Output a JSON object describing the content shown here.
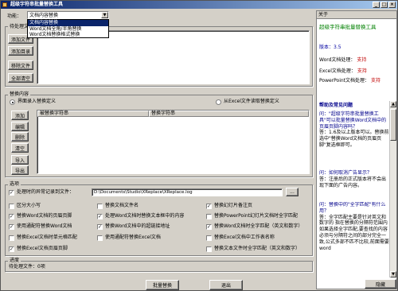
{
  "window": {
    "title": "超级字符串批量替换工具",
    "min": "_",
    "max": "□",
    "close": "×"
  },
  "function": {
    "label": "功能：",
    "selected": "文档内容替换",
    "options": [
      "文档内容替换",
      "Word文档全角/半角替换",
      "Word文档替换格式替换"
    ]
  },
  "files": {
    "group_label": "待处理文件",
    "buttons": [
      "添加文件",
      "添加目录",
      "移除文件",
      "全部清空"
    ]
  },
  "replace": {
    "group_label": "替换内容",
    "radio_ui": "界面录入替换定义",
    "radio_excel": "从Excel文件读取替换定义",
    "col_from": "被替换字符串",
    "col_to": "替换字符串",
    "buttons": [
      "添加",
      "编辑",
      "删除",
      "清空",
      "导入",
      "导出"
    ]
  },
  "options": {
    "group_label": "选项",
    "log_label": "处理时的异常记录到文件：",
    "log_path": "D:\\Documents\\Studio\\XReplace\\XReplace.log",
    "browse": "...",
    "items": [
      {
        "label": "区分大小写",
        "checked": false
      },
      {
        "label": "替换文档文件名",
        "checked": false
      },
      {
        "label": "替换幻灯片备注页",
        "checked": true
      },
      {
        "label": "替换Word文档的页眉页脚",
        "checked": true
      },
      {
        "label": "处理Word文档时替换文本框中的内容",
        "checked": true
      },
      {
        "label": "替换PowerPoint幻灯片文档时全字匹配",
        "checked": false
      },
      {
        "label": "使用通配符替换Word文档",
        "checked": true
      },
      {
        "label": "替换Word文档中的超链接地址",
        "checked": true
      },
      {
        "label": "替换Word文档时全字匹配（英文和数字）",
        "checked": true
      },
      {
        "label": "替换Excel文档时单元格匹配",
        "checked": false
      },
      {
        "label": "使用通配符替换Excel文档",
        "checked": false
      },
      {
        "label": "替换Excel文档中工作表名称",
        "checked": false
      },
      {
        "label": "替换Excel文档页眉页脚",
        "checked": true
      },
      {
        "label": "",
        "checked": false
      },
      {
        "label": "替换文本文件时全字匹配（英文和数字）",
        "checked": false
      }
    ]
  },
  "progress": {
    "group_label": "进度",
    "text": "待处理文件：0项"
  },
  "actions": {
    "run": "批量替换",
    "exit": "退出",
    "hide": "隐藏"
  },
  "about": {
    "title": "关于",
    "app_name": "超级字符串批量替换工具",
    "version": "版本：3.5",
    "word_label": "Word文档处理：",
    "word_status": "支持",
    "excel_label": "Excel文档处理：",
    "excel_status": "支持",
    "ppt_label": "PowerPoint文档处理：",
    "ppt_status": "支持",
    "help_title": "帮助及常见问题",
    "faq": [
      {
        "q": "问：\"超级字符串批量替换工具\"可以批量替换Word文档中的页眉页脚内容吗？",
        "a": "答：1.6及以上版本可以。替换前选中\"替换Word文档的页眉页脚\"复选框即可。"
      },
      {
        "q": "问：如何取消广告显示？",
        "a": "答：注册后的正式版本将不会出现下面的广告内容。"
      },
      {
        "q": "问：替换中的\"全字匹配\"有什么用？",
        "a": "答：全字匹配主要是针对英文和数字的 指在替换的分隔符范围内如果选择全字匹配,要查找的内容必须与分隔符之间的部分完全一致,公式多部不匹不比较,前面需要word"
      }
    ]
  },
  "colors": {
    "titlebar": "#0a246a",
    "green": "#008000",
    "red": "#c00000",
    "link": "#00008b"
  }
}
